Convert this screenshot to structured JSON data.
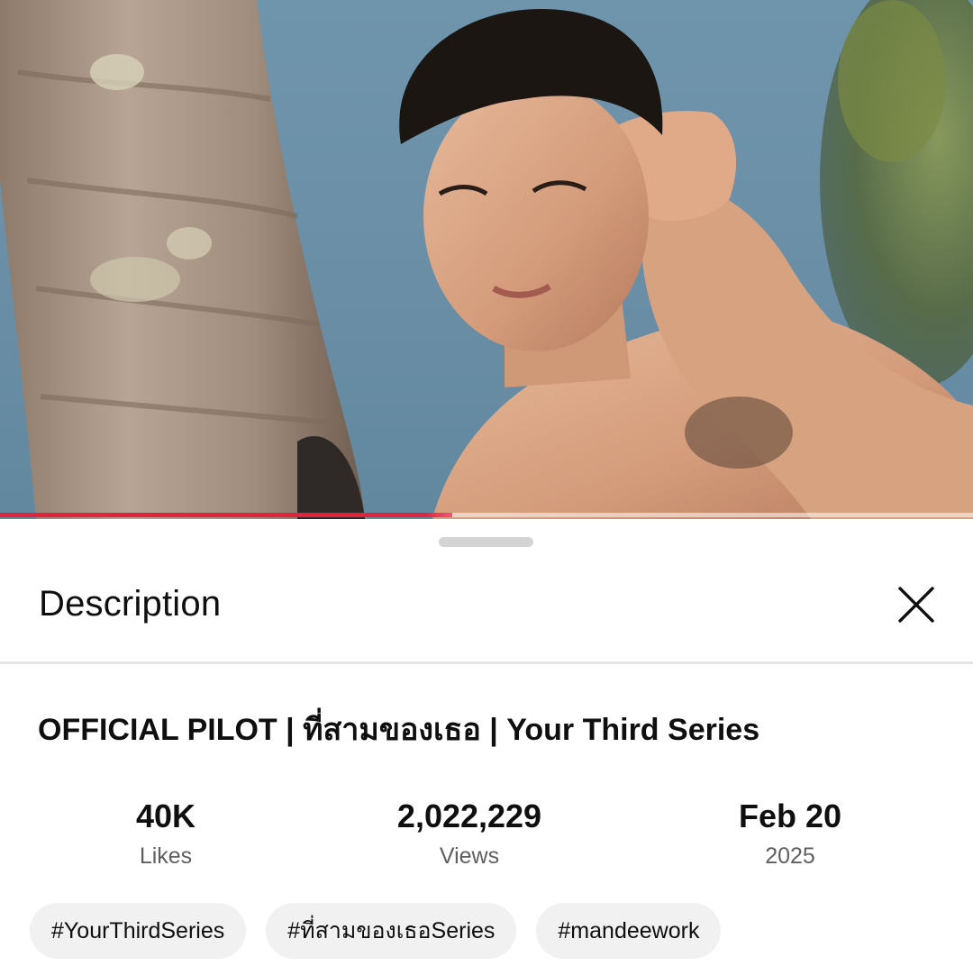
{
  "video": {
    "progress_fraction": 0.465,
    "progress_color": "#e0243e"
  },
  "description_sheet": {
    "heading": "Description",
    "close_icon": "close-icon",
    "video_title": "OFFICIAL PILOT | ที่สามของเธอ | Your Third Series",
    "stats": {
      "likes": {
        "value": "40K",
        "label": "Likes"
      },
      "views": {
        "value": "2,022,229",
        "label": "Views"
      },
      "date": {
        "value": "Feb 20",
        "label": "2025"
      }
    },
    "hashtags": [
      "#YourThirdSeries",
      "#ที่สามของเธอSeries",
      "#mandeework"
    ]
  }
}
